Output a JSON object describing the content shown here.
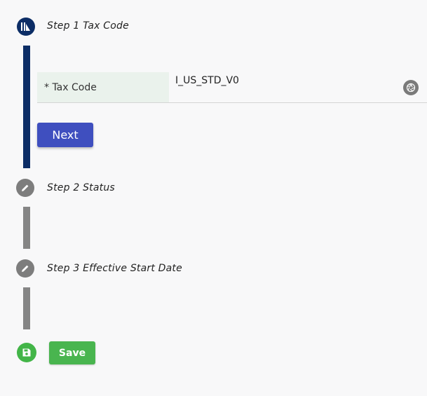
{
  "steps": [
    {
      "label": "Step 1 Tax Code",
      "icon": "step-active-icon"
    },
    {
      "label": "Step 2 Status",
      "icon": "pencil-icon"
    },
    {
      "label": "Step 3 Effective Start Date",
      "icon": "pencil-icon"
    }
  ],
  "tax_code_field": {
    "label": "* Tax Code",
    "value": "I_US_STD_V0",
    "action_icon": "shutter-icon"
  },
  "buttons": {
    "next": "Next",
    "save": "Save"
  },
  "save_icon": "save-icon",
  "colors": {
    "active": "#0c2d66",
    "inactive": "#858585",
    "primary_button": "#3f4fbf",
    "save_green": "#49b54f",
    "label_bg": "#eaf2ec"
  }
}
